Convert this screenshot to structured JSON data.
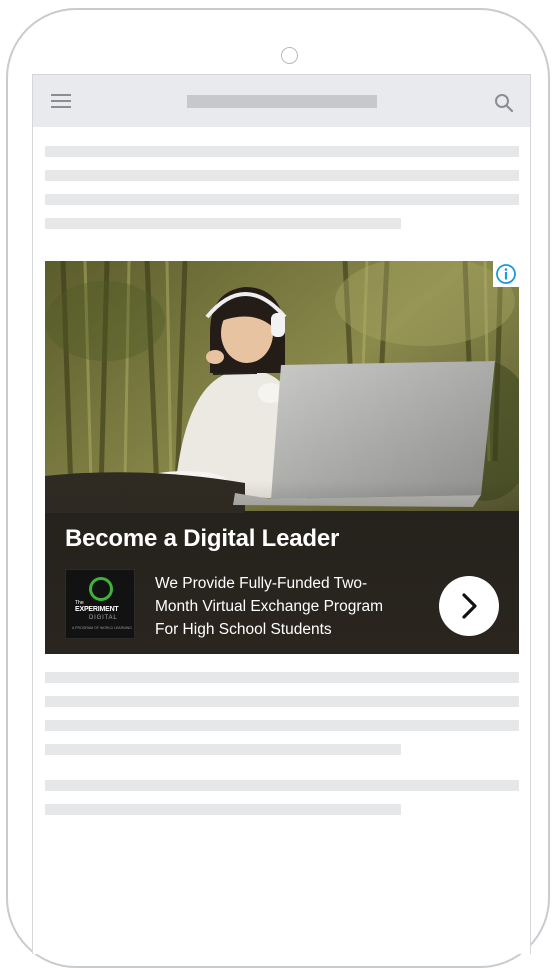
{
  "header": {
    "menu_icon": "hamburger-menu-icon",
    "search_icon": "search-icon"
  },
  "ad": {
    "headline": "Become a Digital Leader",
    "body_lines": [
      "We Provide Fully-Funded Two-",
      "Month Virtual Exchange Program",
      "For High School Students"
    ],
    "logo": {
      "line1": "The",
      "line2": "EXPERIMENT",
      "line3": "DIGITAL",
      "line4": "A PROGRAM OF WORLD LEARNING"
    },
    "info_icon": "info-icon",
    "cta_icon": "chevron-right-icon",
    "colors": {
      "info_blue": "#1a9bd7",
      "logo_green": "#3fb23a",
      "overlay": "#2a261f"
    }
  },
  "colors": {
    "placeholder_line": "#e6e7e9",
    "topbar": "#e9eaed",
    "frame": "#c9cbce"
  }
}
